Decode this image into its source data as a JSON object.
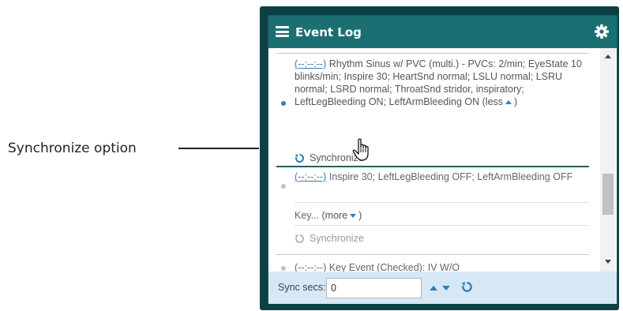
{
  "callout": {
    "label": "Synchronize option"
  },
  "panel": {
    "title": "Event Log",
    "icons": {
      "menu": "hamburger-icon",
      "settings": "gear-icon"
    }
  },
  "entries": [
    {
      "timestamp": "(--:--:--)",
      "text": " Rhythm Sinus w/ PVC (multi.) - PVCs: 2/min; EyeState 10 blinks/min; Inspire 30; HeartSnd normal; LSLU normal; LSRU normal; LSRD normal; ThroatSnd stridor, inspiratory; LeftLegBleeding ON; LeftArmBleeding ON ",
      "toggle": "(less",
      "toggle_end": ")",
      "sync_label": "Synchronize"
    },
    {
      "timestamp": "(--:--:--)",
      "text": " Inspire 30; LeftLegBleeding OFF; LeftArmBleeding OFF",
      "key_text": "Key... ",
      "toggle": "(more",
      "toggle_end": ")",
      "sync_label": "Synchronize"
    },
    {
      "timestamp": "(--:--:--)",
      "text": " Key Event (Checked): IV W/O"
    }
  ],
  "footer": {
    "sync_label": "Sync secs:",
    "sync_value": "0"
  },
  "colors": {
    "titlebar": "#1b6f72",
    "frame": "#0d4045",
    "footer": "#d6e8f5",
    "accent_blue": "#2a80b9",
    "divider": "#1f5f64"
  }
}
